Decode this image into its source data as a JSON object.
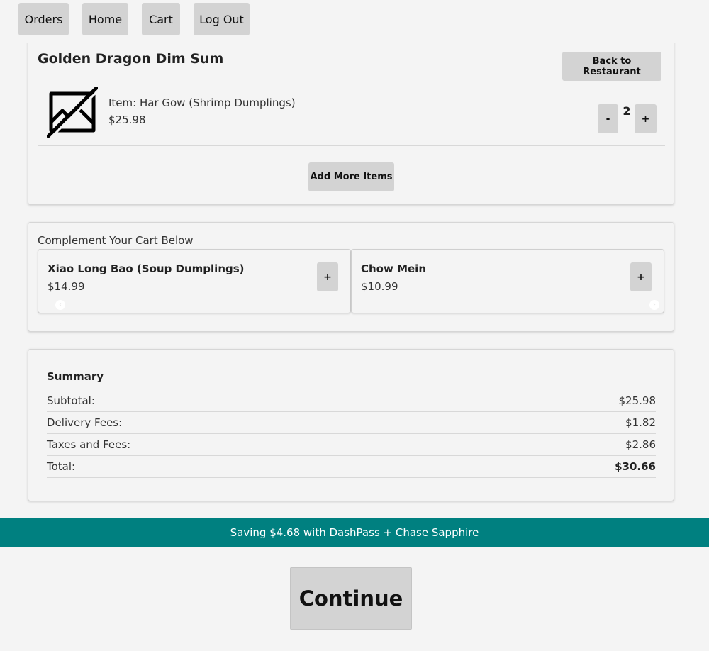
{
  "nav": {
    "orders_label": "Orders",
    "home_label": "Home",
    "cart_label": "Cart",
    "logout_label": "Log Out"
  },
  "cart": {
    "restaurant_name": "Golden Dragon Dim Sum",
    "back_label": "Back to Restaurant",
    "item": {
      "name": "Item: Har Gow (Shrimp Dumplings)",
      "price": "$25.98",
      "quantity": "2",
      "image_icon": "image-off-icon"
    },
    "decrement_label": "-",
    "increment_label": "+",
    "add_more_label": "Add More Items"
  },
  "complement": {
    "title": "Complement Your Cart Below",
    "items": [
      {
        "name": "Xiao Long Bao (Soup Dumplings)",
        "price": "$14.99",
        "add_label": "+"
      },
      {
        "name": "Chow Mein",
        "price": "$10.99",
        "add_label": "+"
      }
    ],
    "prev_icon": "chevron-left-icon",
    "next_icon": "chevron-right-icon"
  },
  "summary": {
    "title": "Summary",
    "rows": [
      {
        "label": "Subtotal:",
        "value": "$25.98"
      },
      {
        "label": "Delivery Fees:",
        "value": "$1.82"
      },
      {
        "label": "Taxes and Fees:",
        "value": "$2.86"
      },
      {
        "label": "Total:",
        "value": "$30.66"
      }
    ]
  },
  "promo": {
    "text": "Saving $4.68 with DashPass + Chase Sapphire",
    "color": "#008080"
  },
  "continue_label": "Continue"
}
